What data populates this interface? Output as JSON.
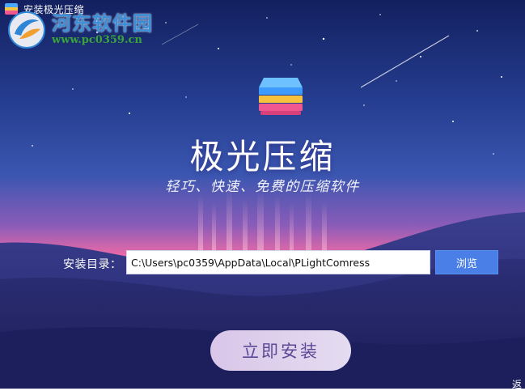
{
  "window": {
    "title": "安装极光压缩"
  },
  "watermark": {
    "brand": "河东软件园",
    "url": "www.pc0359.cn"
  },
  "hero": {
    "app_name": "极光压缩",
    "slogan": "轻巧、快速、免费的压缩软件"
  },
  "install": {
    "label": "安装目录：",
    "path_value": "C:\\Users\\pc0359\\AppData\\Local\\PLightComress",
    "browse_label": "浏览",
    "install_label": "立即安装"
  },
  "corner_text": "返",
  "colors": {
    "sky_top": "#1a2a72",
    "aurora_pink": "#f06aa8",
    "button_blue": "#4a7fe8",
    "install_button": "#ddd0ec",
    "install_text": "#5a4a96"
  },
  "icons": {
    "app": "stacked-layers-icon",
    "watermark": "watermark-logo-icon",
    "main": "stacked-layers-icon"
  }
}
